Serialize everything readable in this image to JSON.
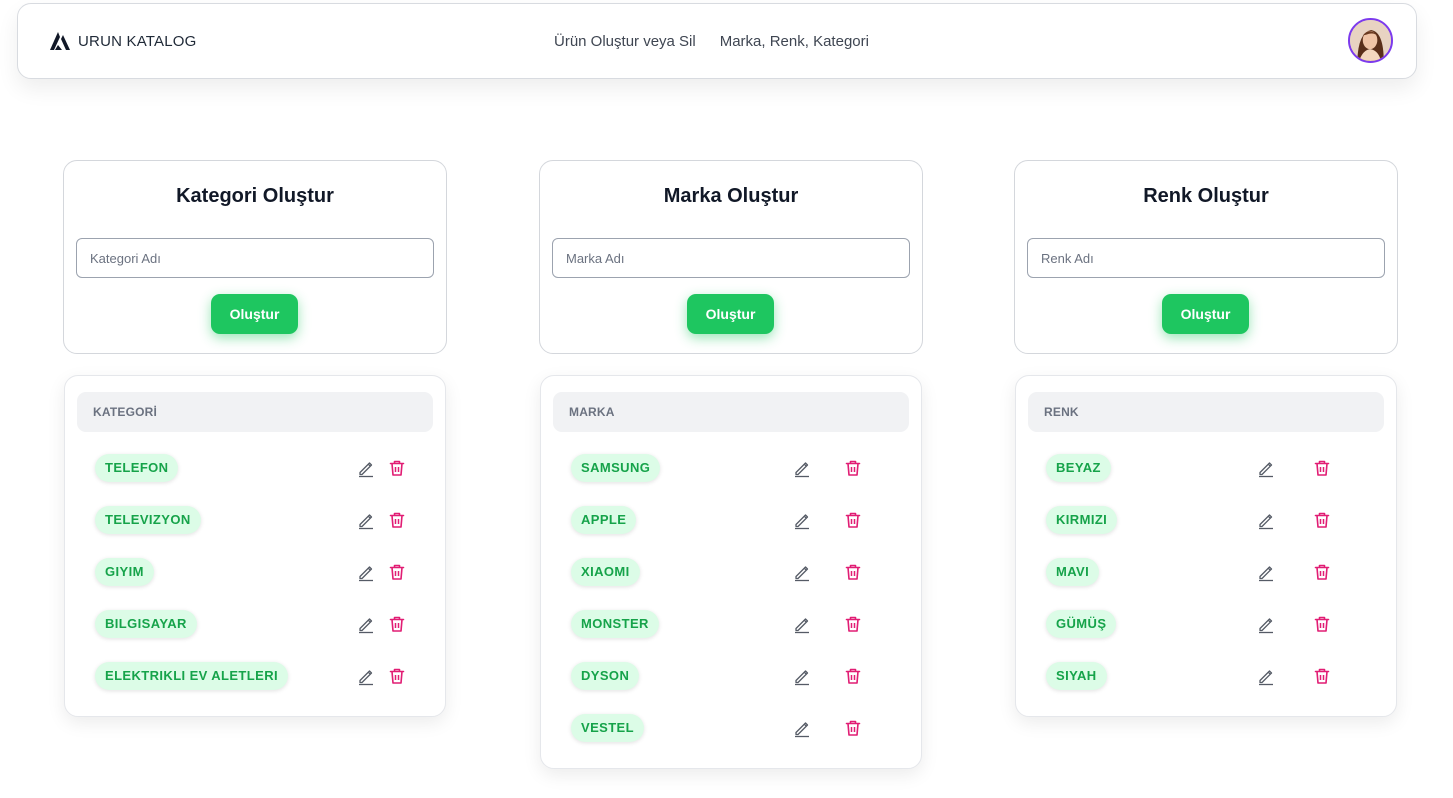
{
  "app": {
    "brand": "URUN KATALOG"
  },
  "nav": {
    "links": [
      "Ürün Oluştur veya Sil",
      "Marka, Renk, Kategori"
    ]
  },
  "colors": {
    "accent": "#1ec660",
    "tag_bg": "#dcfce7",
    "tag_text": "#16a34a",
    "delete": "#e11d74",
    "avatar_ring": "#7c3aed"
  },
  "icons": {
    "edit": "pencil-icon",
    "delete": "trash-icon",
    "logo": "triangle-logo-icon"
  },
  "columns": [
    {
      "title": "Kategori Oluştur",
      "placeholder": "Kategori Adı",
      "button": "Oluştur",
      "list_header": "KATEGORİ",
      "items": [
        "TELEFON",
        "TELEVIZYON",
        "GIYIM",
        "BILGISAYAR",
        "ELEKTRIKLI EV ALETLERI"
      ]
    },
    {
      "title": "Marka Oluştur",
      "placeholder": "Marka Adı",
      "button": "Oluştur",
      "list_header": "MARKA",
      "items": [
        "SAMSUNG",
        "APPLE",
        "XIAOMI",
        "MONSTER",
        "DYSON",
        "VESTEL"
      ]
    },
    {
      "title": "Renk Oluştur",
      "placeholder": "Renk Adı",
      "button": "Oluştur",
      "list_header": "RENK",
      "items": [
        "BEYAZ",
        "KIRMIZI",
        "MAVI",
        "GÜMÜŞ",
        "SIYAH"
      ]
    }
  ]
}
